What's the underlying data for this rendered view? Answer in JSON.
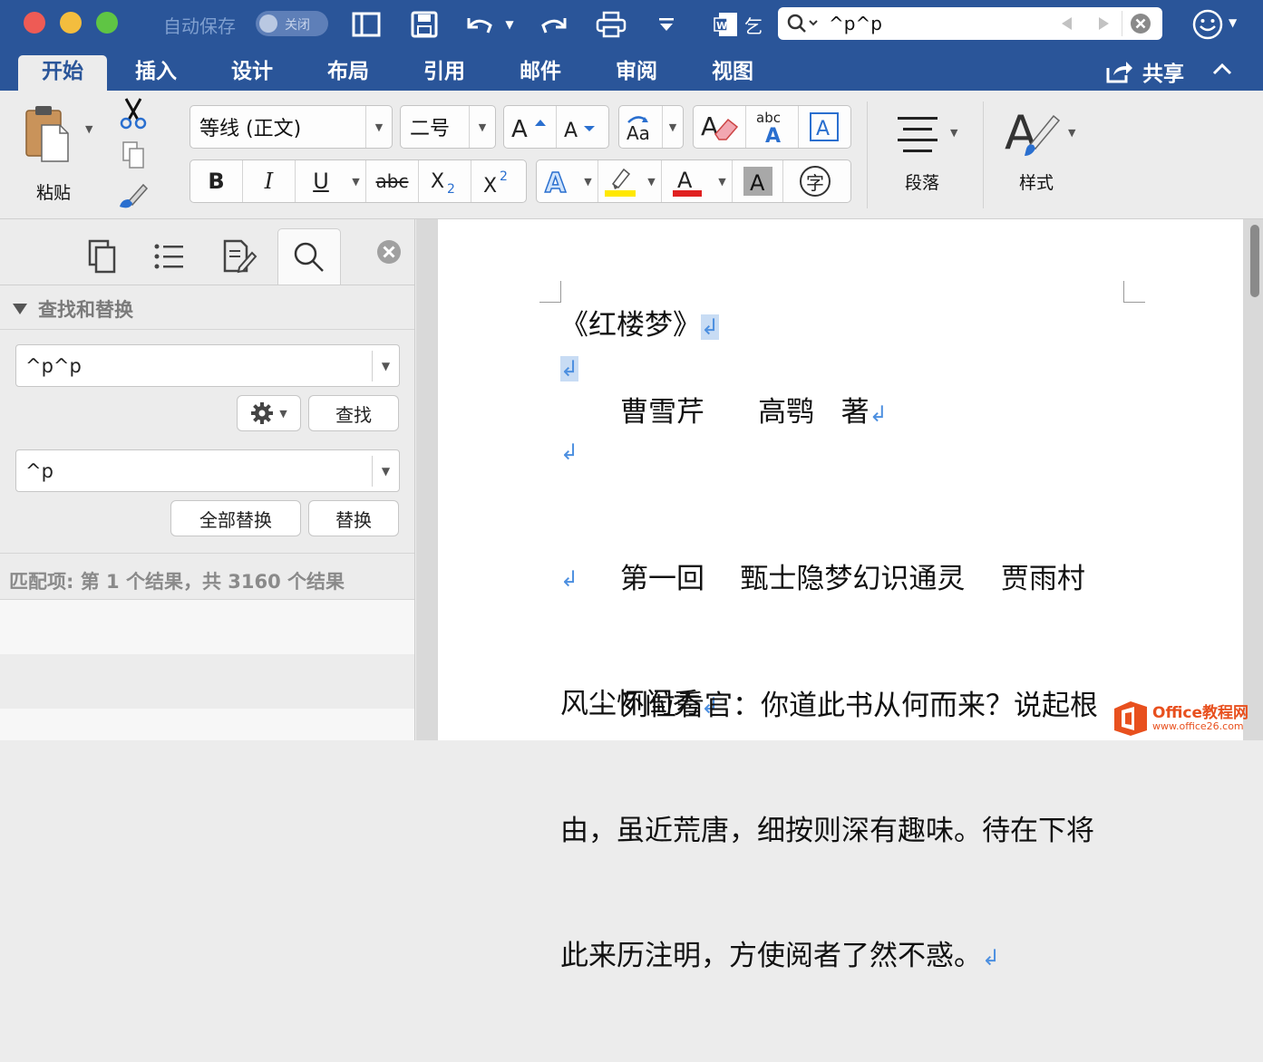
{
  "titlebar": {
    "autosave_label": "自动保存",
    "autosave_state": "关闭",
    "search_value": "^p^p"
  },
  "tabs": [
    "开始",
    "插入",
    "设计",
    "布局",
    "引用",
    "邮件",
    "审阅",
    "视图"
  ],
  "share_label": "共享",
  "ribbon": {
    "paste_label": "粘贴",
    "font_name": "等线 (正文)",
    "font_size": "二号",
    "bold": "B",
    "italic": "I",
    "underline": "U",
    "strike": "abc",
    "paragraph_label": "段落",
    "styles_label": "样式",
    "phonetic_char": "字"
  },
  "pane": {
    "section_title": "查找和替换",
    "find_value": "^p^p",
    "find_button": "查找",
    "replace_value": "^p",
    "replace_all_button": "全部替换",
    "replace_button": "替换",
    "match_status": "匹配项: 第 1 个结果，共 3160 个结果"
  },
  "document": {
    "line1": "《红楼梦》",
    "line3": "曹雪芹      高鹗   著",
    "line5a": "第一回    甄士隐梦幻识通灵    贾雨村",
    "line5b": "风尘怀闺秀",
    "line7a": "列位看官：你道此书从何而来？说起根",
    "line7b": "由，虽近荒唐，细按则深有趣味。待在下将",
    "line7c": "此来历注明，方使阅者了然不惑。",
    "pilcrow": "↲"
  },
  "watermark": {
    "brand": "Office教程网",
    "url": "www.office26.com"
  },
  "colors": {
    "titlebar": "#2a5599",
    "highlight": "#ffe800",
    "font_color": "#e02020",
    "pilcrow": "#4c8fe0"
  }
}
